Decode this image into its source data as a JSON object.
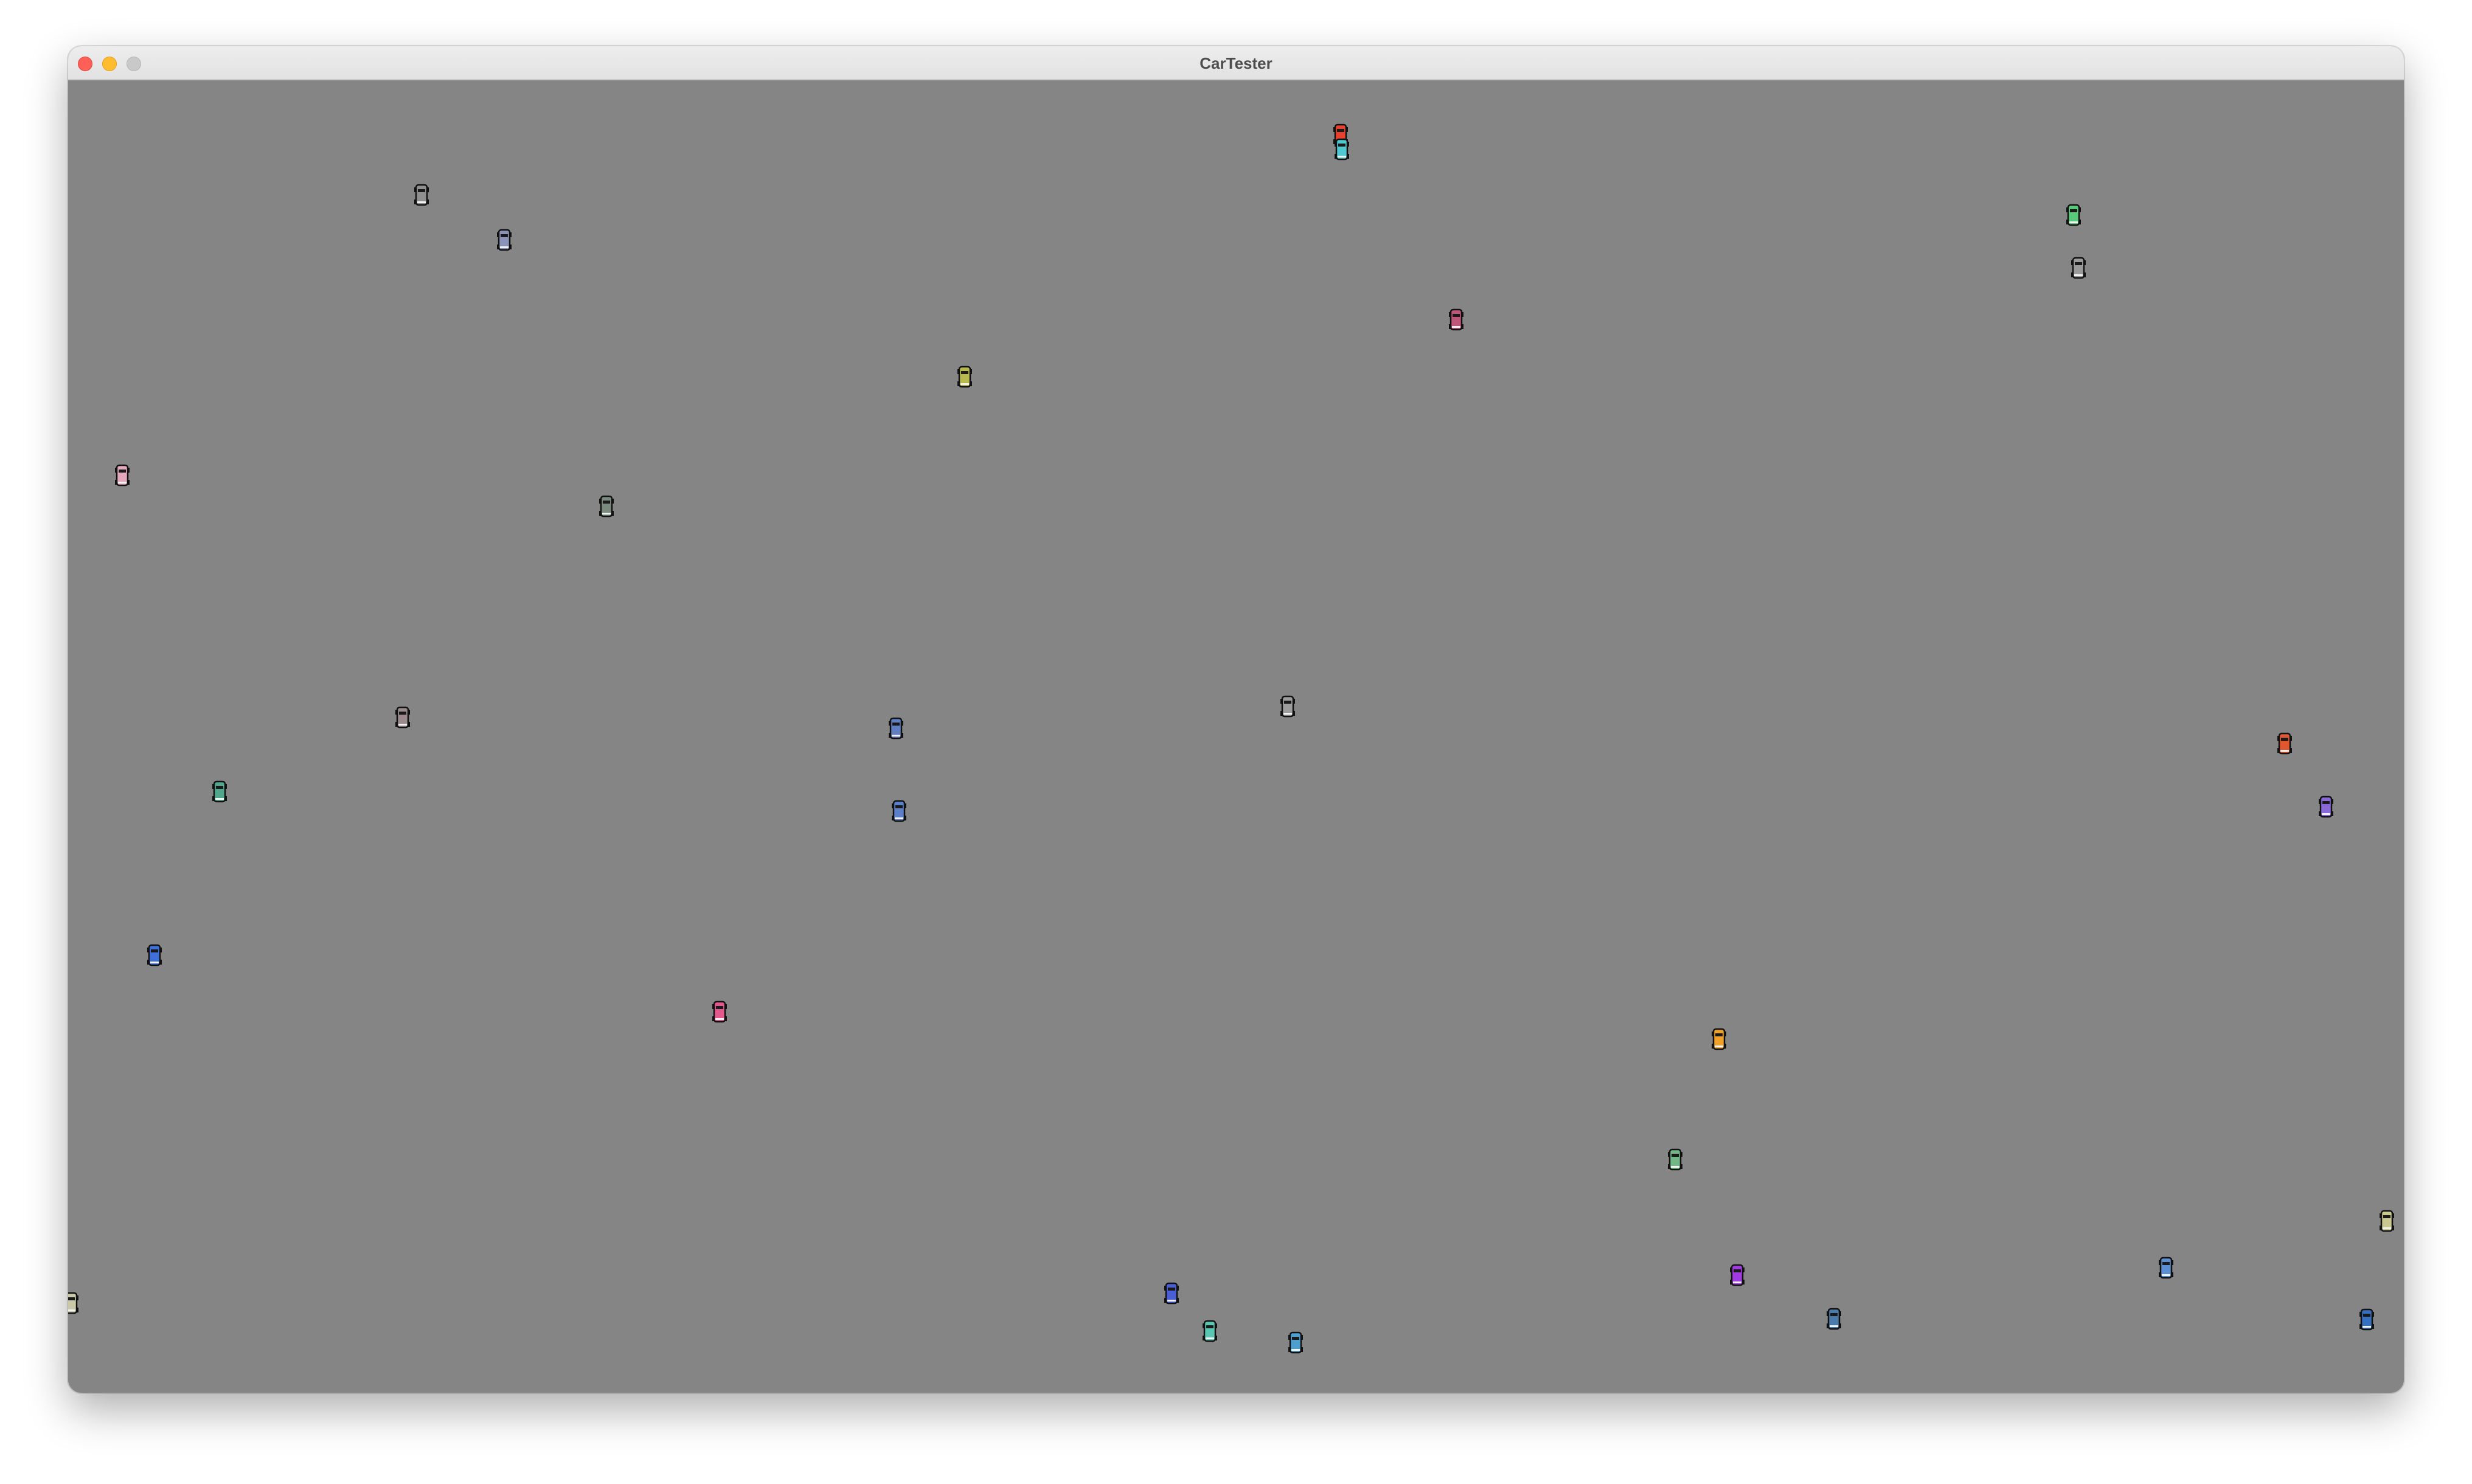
{
  "window": {
    "title": "CarTester",
    "buttons": {
      "close": "close-icon",
      "minimize": "minimize-icon",
      "zoom": "zoom-icon"
    }
  },
  "simulation": {
    "background_color": "#858585",
    "cars": [
      {
        "color": "#e8412f"
      },
      {
        "color": "#4ec9cf"
      },
      {
        "color": "#8f8f8f"
      },
      {
        "color": "#8a94b8"
      },
      {
        "color": "#58c97a"
      },
      {
        "color": "#9a9a9a"
      },
      {
        "color": "#c0557a"
      },
      {
        "color": "#b7b84d"
      },
      {
        "color": "#e3a8bb"
      },
      {
        "color": "#7a8a7e"
      },
      {
        "color": "#9a8a8c"
      },
      {
        "color": "#5f7fc0"
      },
      {
        "color": "#9d9d9d"
      },
      {
        "color": "#e0562e"
      },
      {
        "color": "#4fa78c"
      },
      {
        "color": "#5b80c9"
      },
      {
        "color": "#8a6ad8"
      },
      {
        "color": "#3f6fd8"
      },
      {
        "color": "#e3588d"
      },
      {
        "color": "#f0a12a"
      },
      {
        "color": "#72b688"
      },
      {
        "color": "#c9c98f"
      },
      {
        "color": "#4d9fd0"
      },
      {
        "color": "#4a5fd6"
      },
      {
        "color": "#59c7b2"
      },
      {
        "color": "#4a7cab"
      },
      {
        "color": "#a13ae0"
      },
      {
        "color": "#356fc0"
      },
      {
        "color": "#5a8fd4"
      },
      {
        "color": "#c9c9a8"
      }
    ]
  }
}
